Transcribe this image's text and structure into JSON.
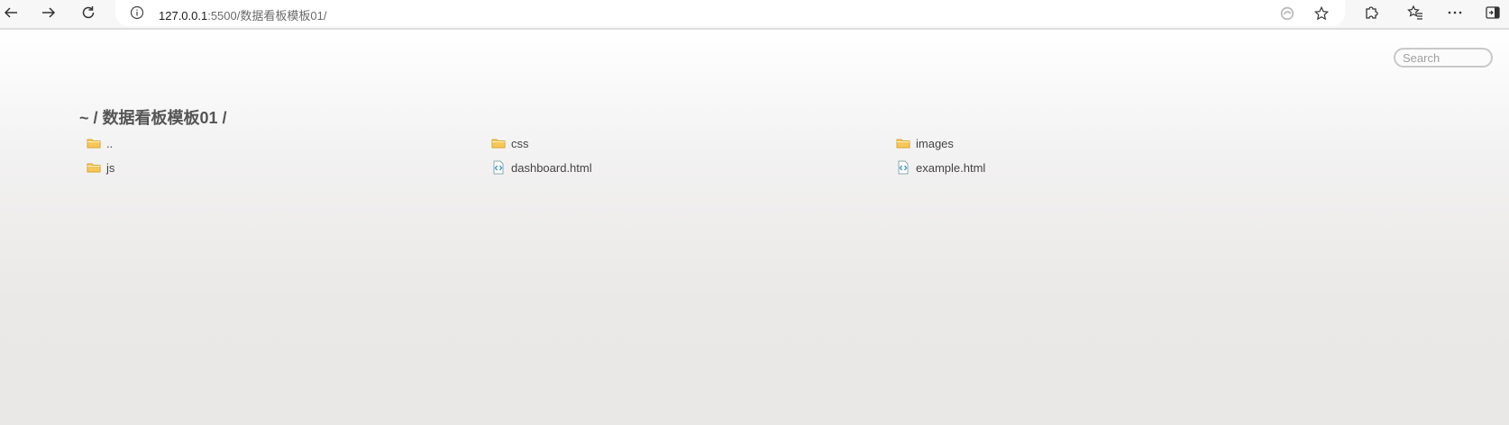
{
  "browser": {
    "url_host": "127.0.0.1",
    "url_path": ":5500/数据看板模板01/",
    "icons": {
      "back": "back-arrow-icon",
      "forward": "forward-arrow-icon",
      "reload": "reload-icon",
      "site_info": "info-icon",
      "tracking": "tracking-prevention-icon",
      "favorite": "star-icon",
      "extensions": "puzzle-icon",
      "favorites": "favorites-icon",
      "menu": "more-icon",
      "sidebar": "sidebar-icon"
    }
  },
  "page": {
    "search_placeholder": "Search",
    "breadcrumb": "~ / 数据看板模板01 /",
    "items": [
      {
        "name": "..",
        "type": "folder"
      },
      {
        "name": "css",
        "type": "folder"
      },
      {
        "name": "images",
        "type": "folder"
      },
      {
        "name": "js",
        "type": "folder"
      },
      {
        "name": "dashboard.html",
        "type": "html"
      },
      {
        "name": "example.html",
        "type": "html"
      }
    ]
  },
  "colors": {
    "folder": "#f6c75a",
    "folder_stroke": "#d9a52b",
    "html_icon": "#2f8fd8",
    "text": "#444444",
    "heading": "#555555"
  }
}
